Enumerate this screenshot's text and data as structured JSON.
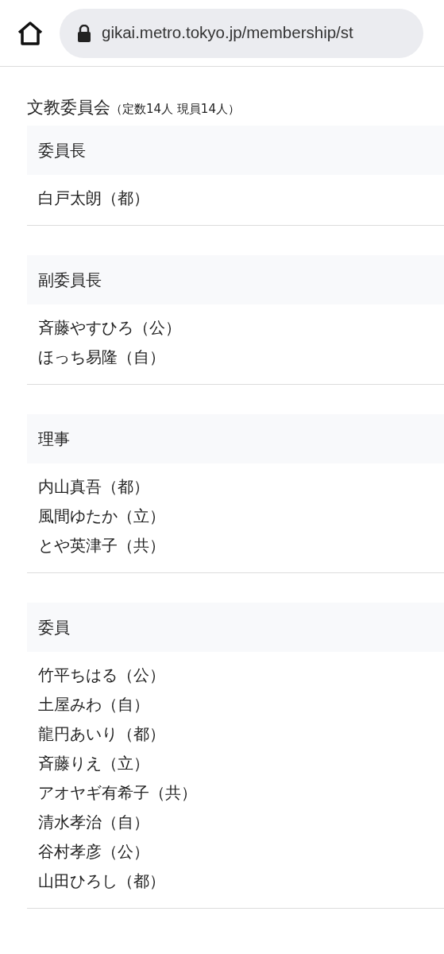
{
  "address_bar": {
    "url": "gikai.metro.tokyo.jp/membership/st"
  },
  "committee": {
    "name": "文教委員会",
    "quota": "（定数14人 現員14人）"
  },
  "sections": [
    {
      "role": "委員長",
      "members": [
        "白戸太朗（都）"
      ]
    },
    {
      "role": "副委員長",
      "members": [
        "斉藤やすひろ（公）",
        "ほっち易隆（自）"
      ]
    },
    {
      "role": "理事",
      "members": [
        "内山真吾（都）",
        "風間ゆたか（立）",
        "とや英津子（共）"
      ]
    },
    {
      "role": "委員",
      "members": [
        "竹平ちはる（公）",
        "土屋みわ（自）",
        "龍円あいり（都）",
        "斉藤りえ（立）",
        "アオヤギ有希子（共）",
        "清水孝治（自）",
        "谷村孝彦（公）",
        "山田ひろし（都）"
      ]
    }
  ]
}
